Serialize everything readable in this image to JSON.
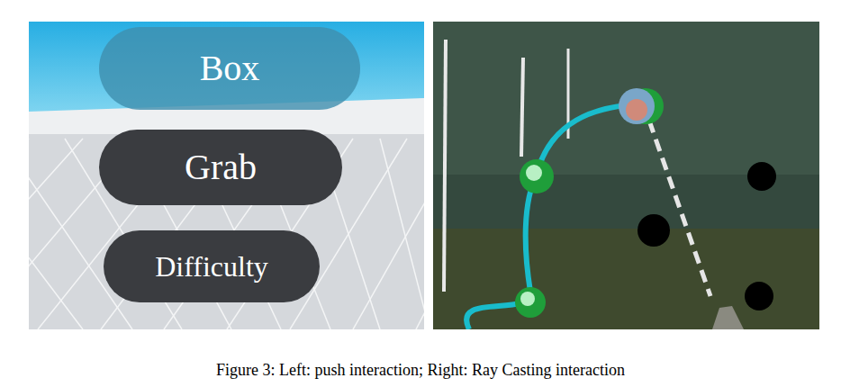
{
  "figure": {
    "panels": [
      {
        "name": "push-interaction",
        "buttons": [
          {
            "label": "Box",
            "pressed": true
          },
          {
            "label": "Grab",
            "pressed": false
          },
          {
            "label": "Difficulty",
            "pressed": false
          }
        ]
      },
      {
        "name": "ray-casting-interaction"
      }
    ],
    "caption": "Figure 3: Left: push interaction; Right: Ray Casting interaction"
  }
}
